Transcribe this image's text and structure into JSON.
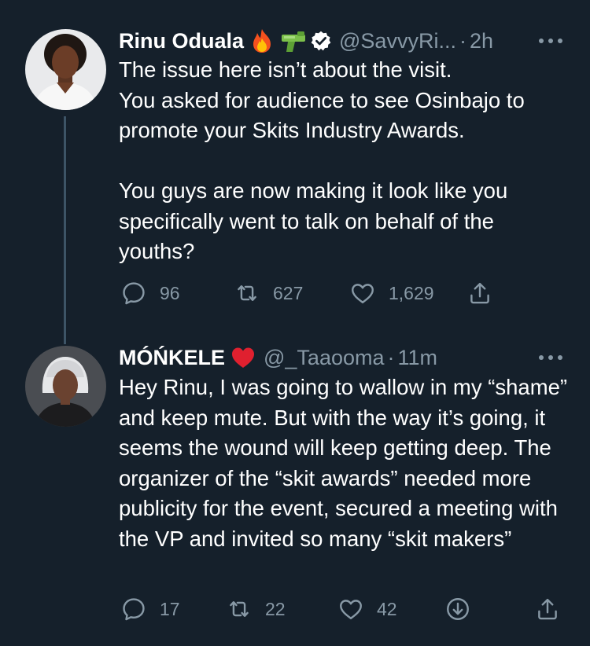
{
  "tweets": [
    {
      "name": "Rinu Oduala",
      "emojis": [
        "fire-emoji",
        "water-pistol-emoji"
      ],
      "verified": true,
      "handle": "@SavvyRi...",
      "separator": "·",
      "time": "2h",
      "paragraphs": [
        "The issue here isn’t about the visit.",
        "You asked for audience to see Osinbajo to promote your Skits Industry Awards.",
        "You guys are now making it look like you specifically went to talk on behalf of the youths?"
      ],
      "reply_count": "96",
      "retweet_count": "627",
      "like_count": "1,629"
    },
    {
      "name": "MÓŃKELE",
      "emojis": [
        "red-heart-emoji"
      ],
      "verified": false,
      "handle": "@_Taaooma",
      "separator": "·",
      "time": "11m",
      "paragraphs": [
        "Hey Rinu, I was going to wallow in my “shame” and keep mute. But with the way it’s going, it seems the wound will keep getting deep. The organizer of the “skit awards” needed more publicity for the event, secured a meeting with the VP and invited so many “skit makers”"
      ],
      "reply_count": "17",
      "retweet_count": "22",
      "like_count": "42"
    }
  ],
  "colors": {
    "background": "#15202b",
    "text": "#ffffff",
    "secondary": "#8899a6",
    "thread_line": "#3d5466",
    "verified_badge": "#ffffff",
    "heart_emoji": "#e0202f"
  }
}
